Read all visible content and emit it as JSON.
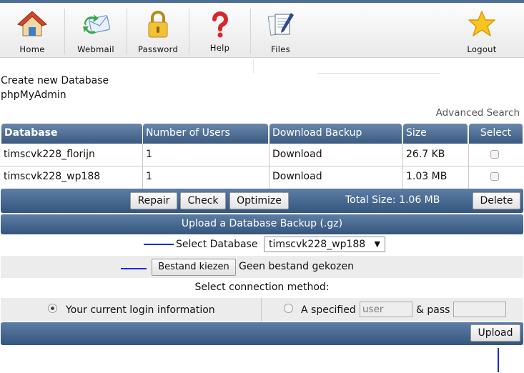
{
  "nav": {
    "items": [
      {
        "label": "Home",
        "icon": "house-icon"
      },
      {
        "label": "Webmail",
        "icon": "mail-icon"
      },
      {
        "label": "Password",
        "icon": "padlock-icon"
      },
      {
        "label": "Help",
        "icon": "question-mark-icon"
      },
      {
        "label": "Files",
        "icon": "files-icon"
      },
      {
        "label": "Logout",
        "icon": "star-icon"
      }
    ]
  },
  "links": {
    "create_db": "Create new Database",
    "phpmyadmin": "phpMyAdmin",
    "advanced_search": "Advanced Search"
  },
  "table": {
    "headers": [
      "Database",
      "Number of Users",
      "Download Backup",
      "Size",
      "Select"
    ],
    "rows": [
      {
        "database": "timscvk228_florijn",
        "users": "1",
        "download": "Download",
        "size": "26.7 KB"
      },
      {
        "database": "timscvk228_wp188",
        "users": "1",
        "download": "Download",
        "size": "1.03 MB"
      }
    ]
  },
  "actions": {
    "repair": "Repair",
    "check": "Check",
    "optimize": "Optimize",
    "total_size": "Total Size: 1.06 MB",
    "delete": "Delete"
  },
  "upload": {
    "title": "Upload a Database Backup (.gz)",
    "select_label": "Select Database",
    "selected_db": "timscvk228_wp188",
    "file_button": "Bestand kiezen",
    "file_status": "Geen bestand gekozen",
    "connection_label": "Select connection method:",
    "option_current": "Your current login information",
    "option_specified": "A specified",
    "user_placeholder": "user",
    "pass_label": "& pass",
    "upload_button": "Upload"
  },
  "colors": {
    "header_blue": "#3b5a80",
    "annotation_mark": "#1a2bd6"
  }
}
